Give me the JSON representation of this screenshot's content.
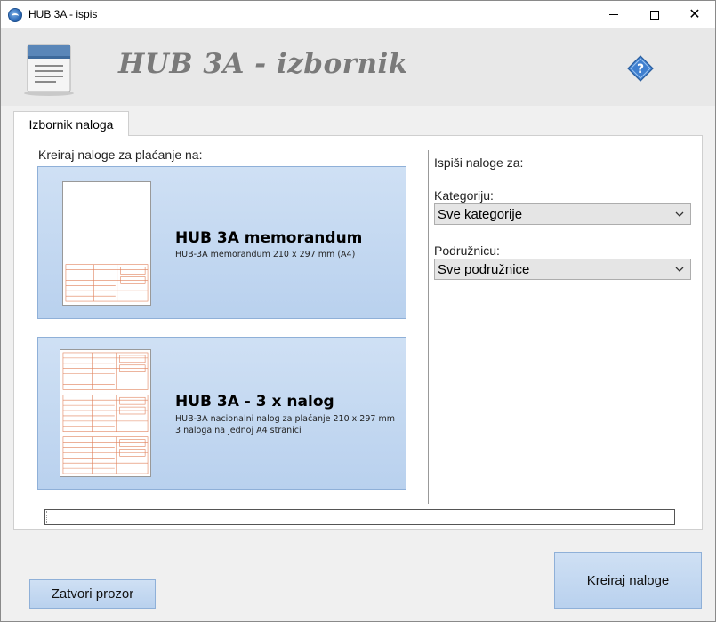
{
  "window": {
    "title": "HUB 3A - ispis",
    "minimize_icon": "minimize-icon",
    "maximize_icon": "maximize-icon",
    "close_icon": "close-icon",
    "close_glyph": "✕"
  },
  "header": {
    "title": "HUB 3A - izbornik",
    "logo_icon": "document-icon",
    "help_icon": "help-icon"
  },
  "tabs": [
    {
      "label": "Izbornik naloga",
      "active": true
    }
  ],
  "left": {
    "label": "Kreiraj naloge za plaćanje na:",
    "cards": [
      {
        "title": "HUB 3A memorandum",
        "subtitle_lines": [
          "HUB-3A memorandum 210 x 297 mm  (A4)"
        ]
      },
      {
        "title": "HUB 3A - 3 x nalog",
        "subtitle_lines": [
          "HUB-3A nacionalni nalog za plaćanje 210 x 297 mm",
          "3 naloga na jednoj A4 stranici"
        ]
      }
    ]
  },
  "right": {
    "heading": "Ispiši naloge za:",
    "category_label": "Kategoriju:",
    "category_value": "Sve kategorije",
    "branch_label": "Podružnicu:",
    "branch_value": "Sve podružnice"
  },
  "progress": {
    "value": 0
  },
  "buttons": {
    "close": "Zatvori prozor",
    "create": "Kreiraj naloge"
  },
  "colors": {
    "accent": "#b9d1ee",
    "accent_border": "#8fb0d8",
    "form_lines": "#e0805a"
  }
}
